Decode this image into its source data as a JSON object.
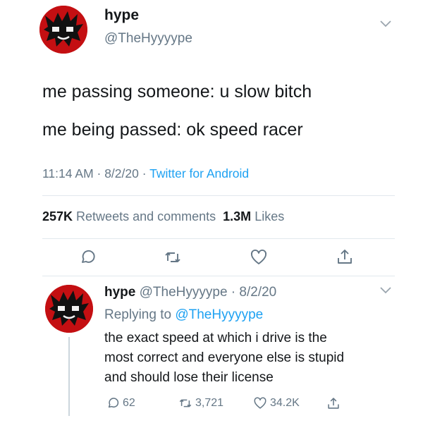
{
  "tweet": {
    "name": "hype",
    "handle": "@TheHyyyype",
    "lines": [
      "me passing someone: u slow bitch",
      "me being passed: ok speed racer"
    ],
    "time": "11:14 AM",
    "date": "8/2/20",
    "source": "Twitter for Android",
    "separator": " · ",
    "retweets_count": "257K",
    "retweets_label": "Retweets and comments",
    "likes_count": "1.3M",
    "likes_label": "Likes"
  },
  "reply": {
    "name": "hype",
    "handle": "@TheHyyyype",
    "date": "8/2/20",
    "separator": " · ",
    "replying_prefix": "Replying to",
    "replying_to": "@TheHyyyype",
    "lines": [
      "the exact speed at which i drive is the",
      "most correct and everyone else is stupid",
      "and should lose their license"
    ],
    "reply_count": "62",
    "retweet_count": "3,721",
    "like_count": "34.2K"
  },
  "colors": {
    "accent": "#1da1f2",
    "secondary_text": "#657786",
    "avatar": "#c40f12"
  },
  "icons": [
    "caret-down-icon",
    "reply-icon",
    "retweet-icon",
    "like-icon",
    "share-icon"
  ]
}
